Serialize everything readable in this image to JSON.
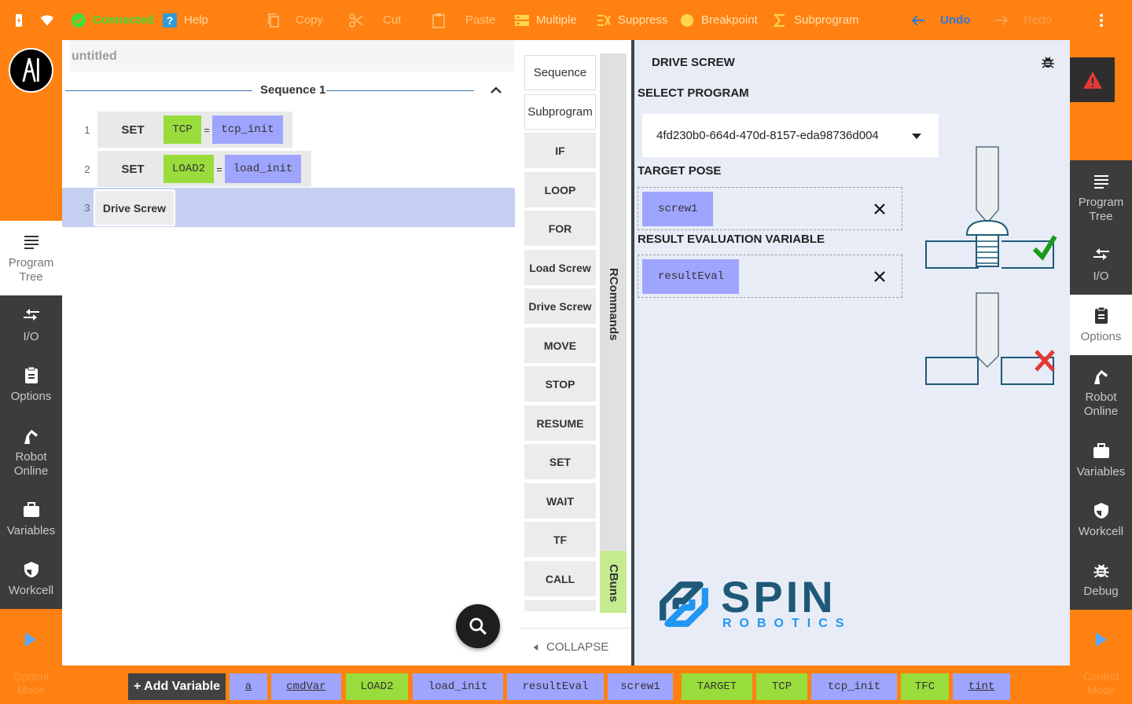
{
  "topbar": {
    "status": "Connected",
    "help": "Help",
    "copy": "Copy",
    "cut": "Cut",
    "paste": "Paste",
    "multiple": "Multiple",
    "suppress": "Suppress",
    "breakpoint": "Breakpoint",
    "subprogram": "Subprogram",
    "undo": "Undo",
    "redo": "Redo"
  },
  "left_nav": [
    {
      "label": "Program\nTree",
      "icon": "program-tree-icon",
      "active": true
    },
    {
      "label": "I/O",
      "icon": "io-icon"
    },
    {
      "label": "Options",
      "icon": "clipboard-icon"
    },
    {
      "label": "Robot\nOnline",
      "icon": "robot-arm-icon"
    },
    {
      "label": "Variables",
      "icon": "briefcase-icon"
    },
    {
      "label": "Workcell",
      "icon": "shield-icon"
    }
  ],
  "right_nav": [
    {
      "label": "Program\nTree",
      "icon": "program-tree-icon"
    },
    {
      "label": "I/O",
      "icon": "io-icon"
    },
    {
      "label": "Options",
      "icon": "clipboard-icon",
      "active": true
    },
    {
      "label": "Robot\nOnline",
      "icon": "robot-arm-icon"
    },
    {
      "label": "Variables",
      "icon": "briefcase-icon"
    },
    {
      "label": "Workcell",
      "icon": "shield-icon"
    },
    {
      "label": "Debug",
      "icon": "bug-icon"
    }
  ],
  "control_mode": "Control\nMode",
  "program": {
    "title": "untitled",
    "sequence": "Sequence 1",
    "lines": [
      {
        "num": "1",
        "kw": "SET",
        "var": "TCP",
        "eq": "=",
        "val": "tcp_init"
      },
      {
        "num": "2",
        "kw": "SET",
        "var": "LOAD2",
        "eq": "=",
        "val": "load_init"
      },
      {
        "num": "3",
        "kw": "Drive Screw"
      }
    ]
  },
  "commands": [
    "Sequence",
    "Subprogram",
    "IF",
    "LOOP",
    "FOR",
    "Load Screw",
    "Drive Screw",
    "MOVE",
    "STOP",
    "RESUME",
    "SET",
    "WAIT",
    "TF",
    "CALL"
  ],
  "command_tabs": {
    "rcommands": "RCommands",
    "cbuns": "CBuns"
  },
  "collapse": "COLLAPSE",
  "detail": {
    "title": "DRIVE SCREW",
    "select_program_label": "SELECT PROGRAM",
    "program_id": "4fd230b0-664d-470d-8157-eda98736d004",
    "target_pose_label": "TARGET POSE",
    "target_pose": "screw1",
    "result_label": "RESULT EVALUATION VARIABLE",
    "result_var": "resultEval",
    "brand_main": "SPIN",
    "brand_sub": "ROBOTICS"
  },
  "bottombar": {
    "add_variable": "+ Add Variable",
    "variables": [
      {
        "name": "a",
        "color": "#9fa4ff",
        "underline": true
      },
      {
        "name": "cmdVar",
        "color": "#9fa4ff",
        "underline": true
      },
      {
        "name": "LOAD2",
        "color": "#98dd3b"
      },
      {
        "name": "load_init",
        "color": "#9fa4ff"
      },
      {
        "name": "resultEval",
        "color": "#9fa4ff"
      },
      {
        "name": "screw1",
        "color": "#9fa4ff"
      },
      {
        "name": "TARGET",
        "color": "#98dd3b"
      },
      {
        "name": "TCP",
        "color": "#98dd3b"
      },
      {
        "name": "tcp_init",
        "color": "#9fa4ff"
      },
      {
        "name": "TFC",
        "color": "#98dd3b"
      },
      {
        "name": "tint",
        "color": "#9fa4ff",
        "underline": true
      }
    ]
  },
  "colors": {
    "accent": "#ff8111",
    "dark_nav": "#3c3c3c",
    "chip_green": "#98dd3b",
    "chip_purple": "#9fa4ff"
  }
}
